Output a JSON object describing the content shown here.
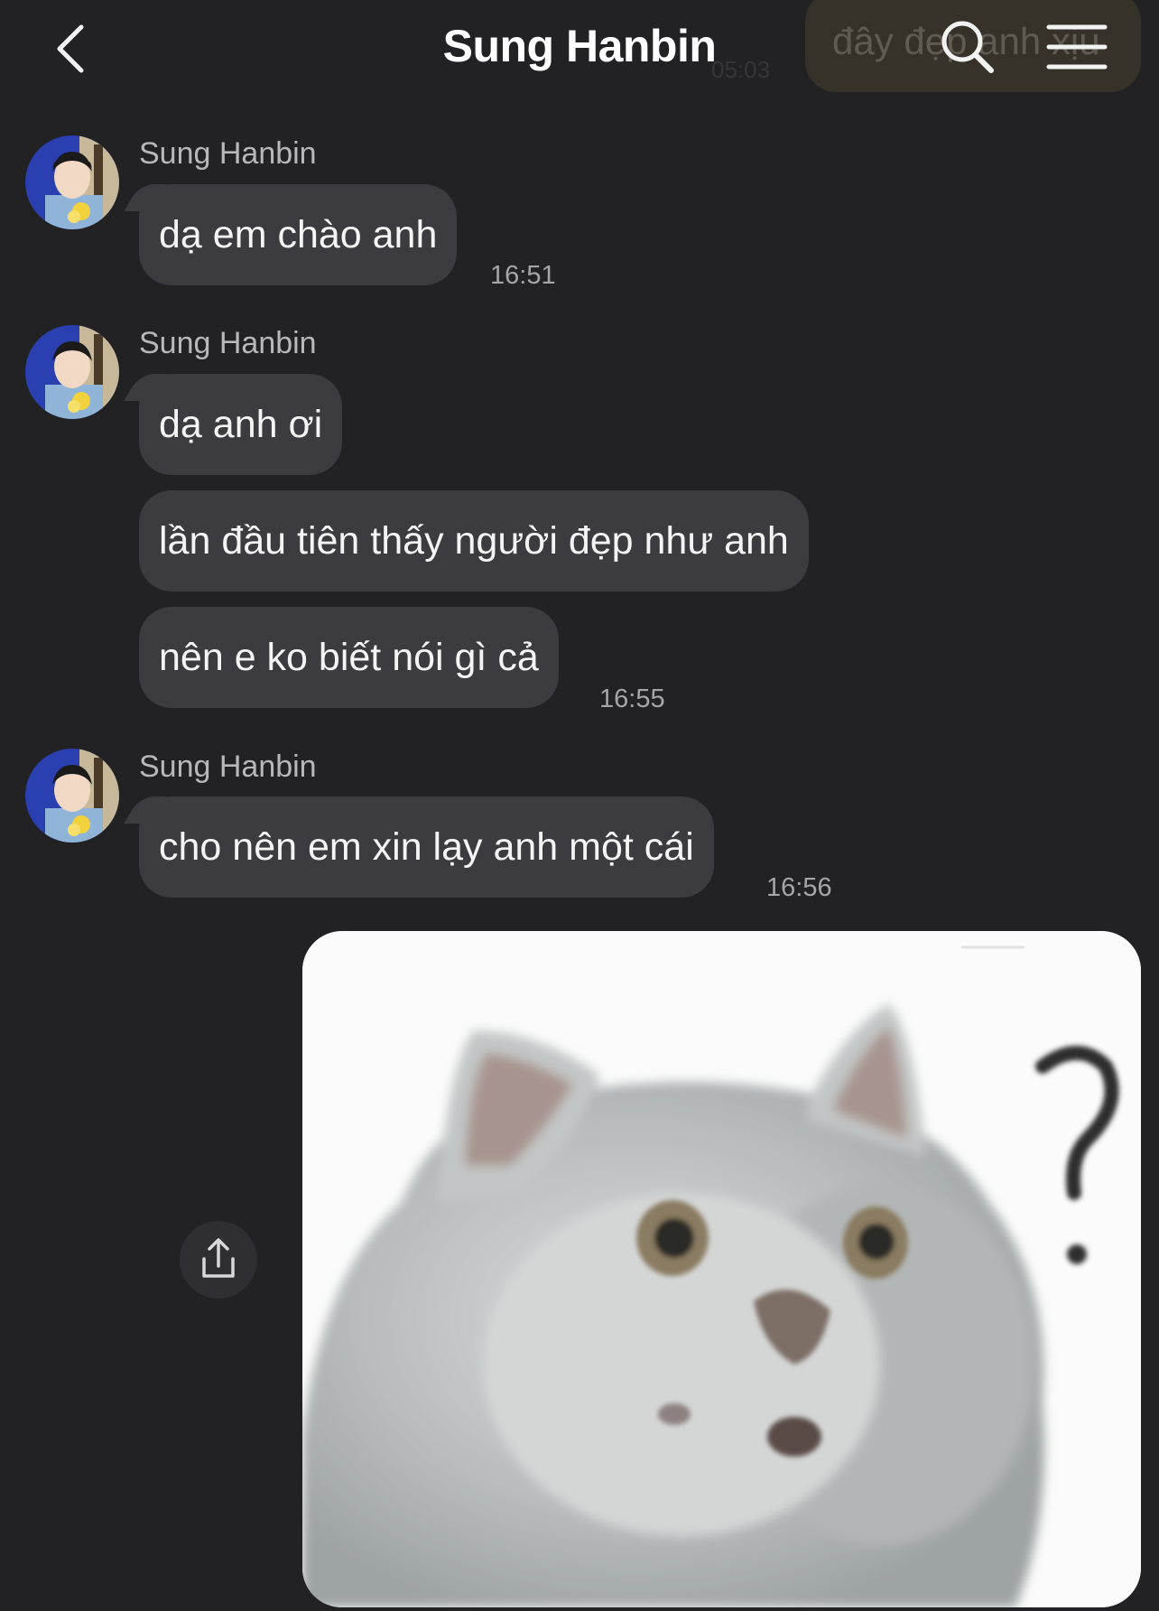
{
  "header": {
    "title": "Sung Hanbin",
    "back_icon": "chevron-left-icon",
    "search_icon": "search-icon",
    "menu_icon": "menu-icon",
    "peek_message": "đây đẹp anh xịu",
    "peek_time": "05:03"
  },
  "colors": {
    "background": "#222225",
    "bubble": "#3b3b40",
    "text": "#f4f4f4",
    "muted": "#a6a6aa"
  },
  "messages": [
    {
      "sender": "Sung Hanbin",
      "bubbles": [
        "dạ em chào anh"
      ],
      "time": "16:51"
    },
    {
      "sender": "Sung Hanbin",
      "bubbles": [
        "dạ anh ơi",
        "lần đầu tiên thấy người đẹp như anh",
        "nên e ko biết nói gì cả"
      ],
      "time": "16:55"
    },
    {
      "sender": "Sung Hanbin",
      "bubbles": [
        "cho nên em xin lạy anh một cái"
      ],
      "time": "16:56"
    }
  ],
  "image_message": {
    "share_icon": "share-icon",
    "content": "cat-image"
  }
}
